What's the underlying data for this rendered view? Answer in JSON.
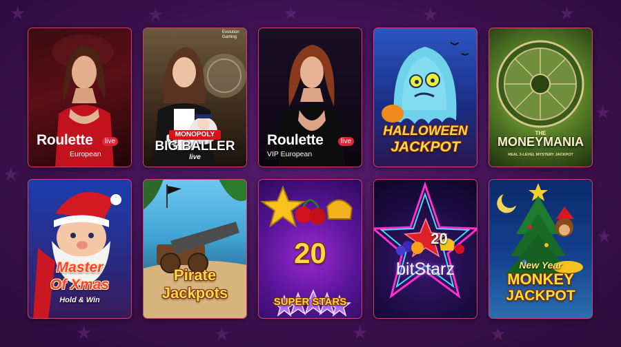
{
  "games": [
    {
      "title": "Roulette",
      "badge": "live",
      "subtitle": "European"
    },
    {
      "brand": "MONOPOLY",
      "title": "BIG BALLER",
      "tag": "live",
      "provider": "Evolution Gaming"
    },
    {
      "title": "Roulette",
      "badge": "live",
      "subtitle": "VIP European"
    },
    {
      "title_line1": "HALLOWEEN",
      "title_line2": "JACKPOT"
    },
    {
      "title_top": "THE",
      "title": "MONEYMANIA",
      "subtitle": "REAL 3-LEVEL MYSTERY JACKPOT"
    },
    {
      "title_line1": "Master",
      "title_line2": "Of Xmas",
      "subtitle": "Hold & Win"
    },
    {
      "title_line1": "Pirate",
      "title_line2": "Jackpots"
    },
    {
      "number": "20",
      "title": "SUPER STARS"
    },
    {
      "number": "20",
      "title": "bitStarz"
    },
    {
      "title_top": "New Year",
      "title_line1": "MONKEY",
      "title_line2": "JACKPOT"
    }
  ],
  "colors": {
    "background": "#3d1250",
    "tile_border": "#d63f74",
    "live_badge": "#e02437"
  }
}
